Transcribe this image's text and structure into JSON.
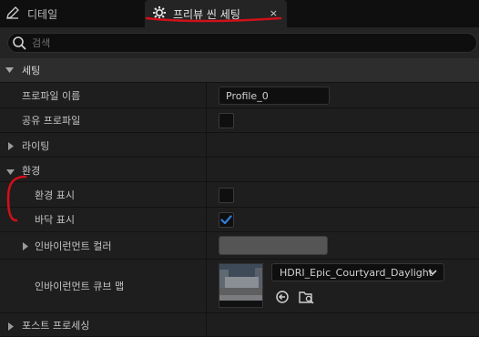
{
  "tabs": {
    "details": {
      "label": "디테일"
    },
    "preview": {
      "label": "프리뷰 씬 세팅",
      "close": "×"
    }
  },
  "search": {
    "placeholder": "검색"
  },
  "settings": {
    "category": "세팅",
    "profile_name": {
      "label": "프로파일 이름",
      "value": "Profile_0"
    },
    "shared_profile": {
      "label": "공유 프로파일",
      "checked": false
    }
  },
  "lighting": {
    "category": "라이팅"
  },
  "environment": {
    "category": "환경",
    "show_environment": {
      "label": "환경 표시",
      "checked": false
    },
    "show_floor": {
      "label": "바닥 표시",
      "checked": true
    },
    "environment_color": {
      "label": "인바이런먼트 컬러",
      "color": "#555555"
    },
    "environment_cubemap": {
      "label": "인바이런먼트 큐브 맵",
      "asset": "HDRI_Epic_Courtyard_Daylight"
    }
  },
  "post_processing": {
    "category": "포스트 프로세싱"
  },
  "colors": {
    "accent": "#2f7fe0",
    "annotation_red": "#d0101a"
  }
}
